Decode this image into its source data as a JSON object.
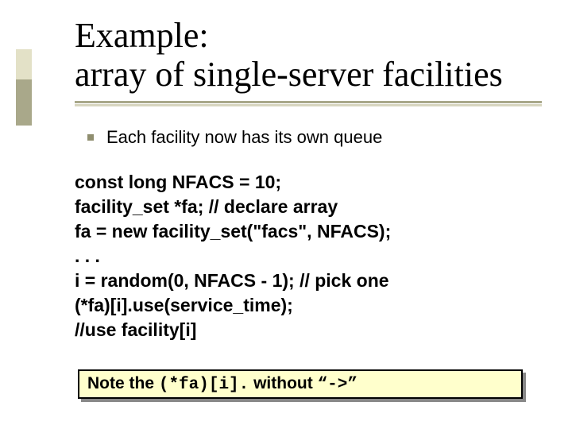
{
  "title_line1": "Example:",
  "title_line2": "array of single-server facilities",
  "bullet": "Each facility now has its own queue",
  "code_lines": [
    "const long NFACS = 10;",
    "facility_set *fa; // declare array",
    "fa = new facility_set(\"facs\", NFACS);",
    ". . .",
    "i = random(0, NFACS - 1); // pick one",
    "(*fa)[i].use(service_time);",
    "//use facility[i]"
  ],
  "note": {
    "prefix": "Note the ",
    "mono1": "(*fa)[i].",
    "mid": "  without  ",
    "mono2": "“->”"
  }
}
